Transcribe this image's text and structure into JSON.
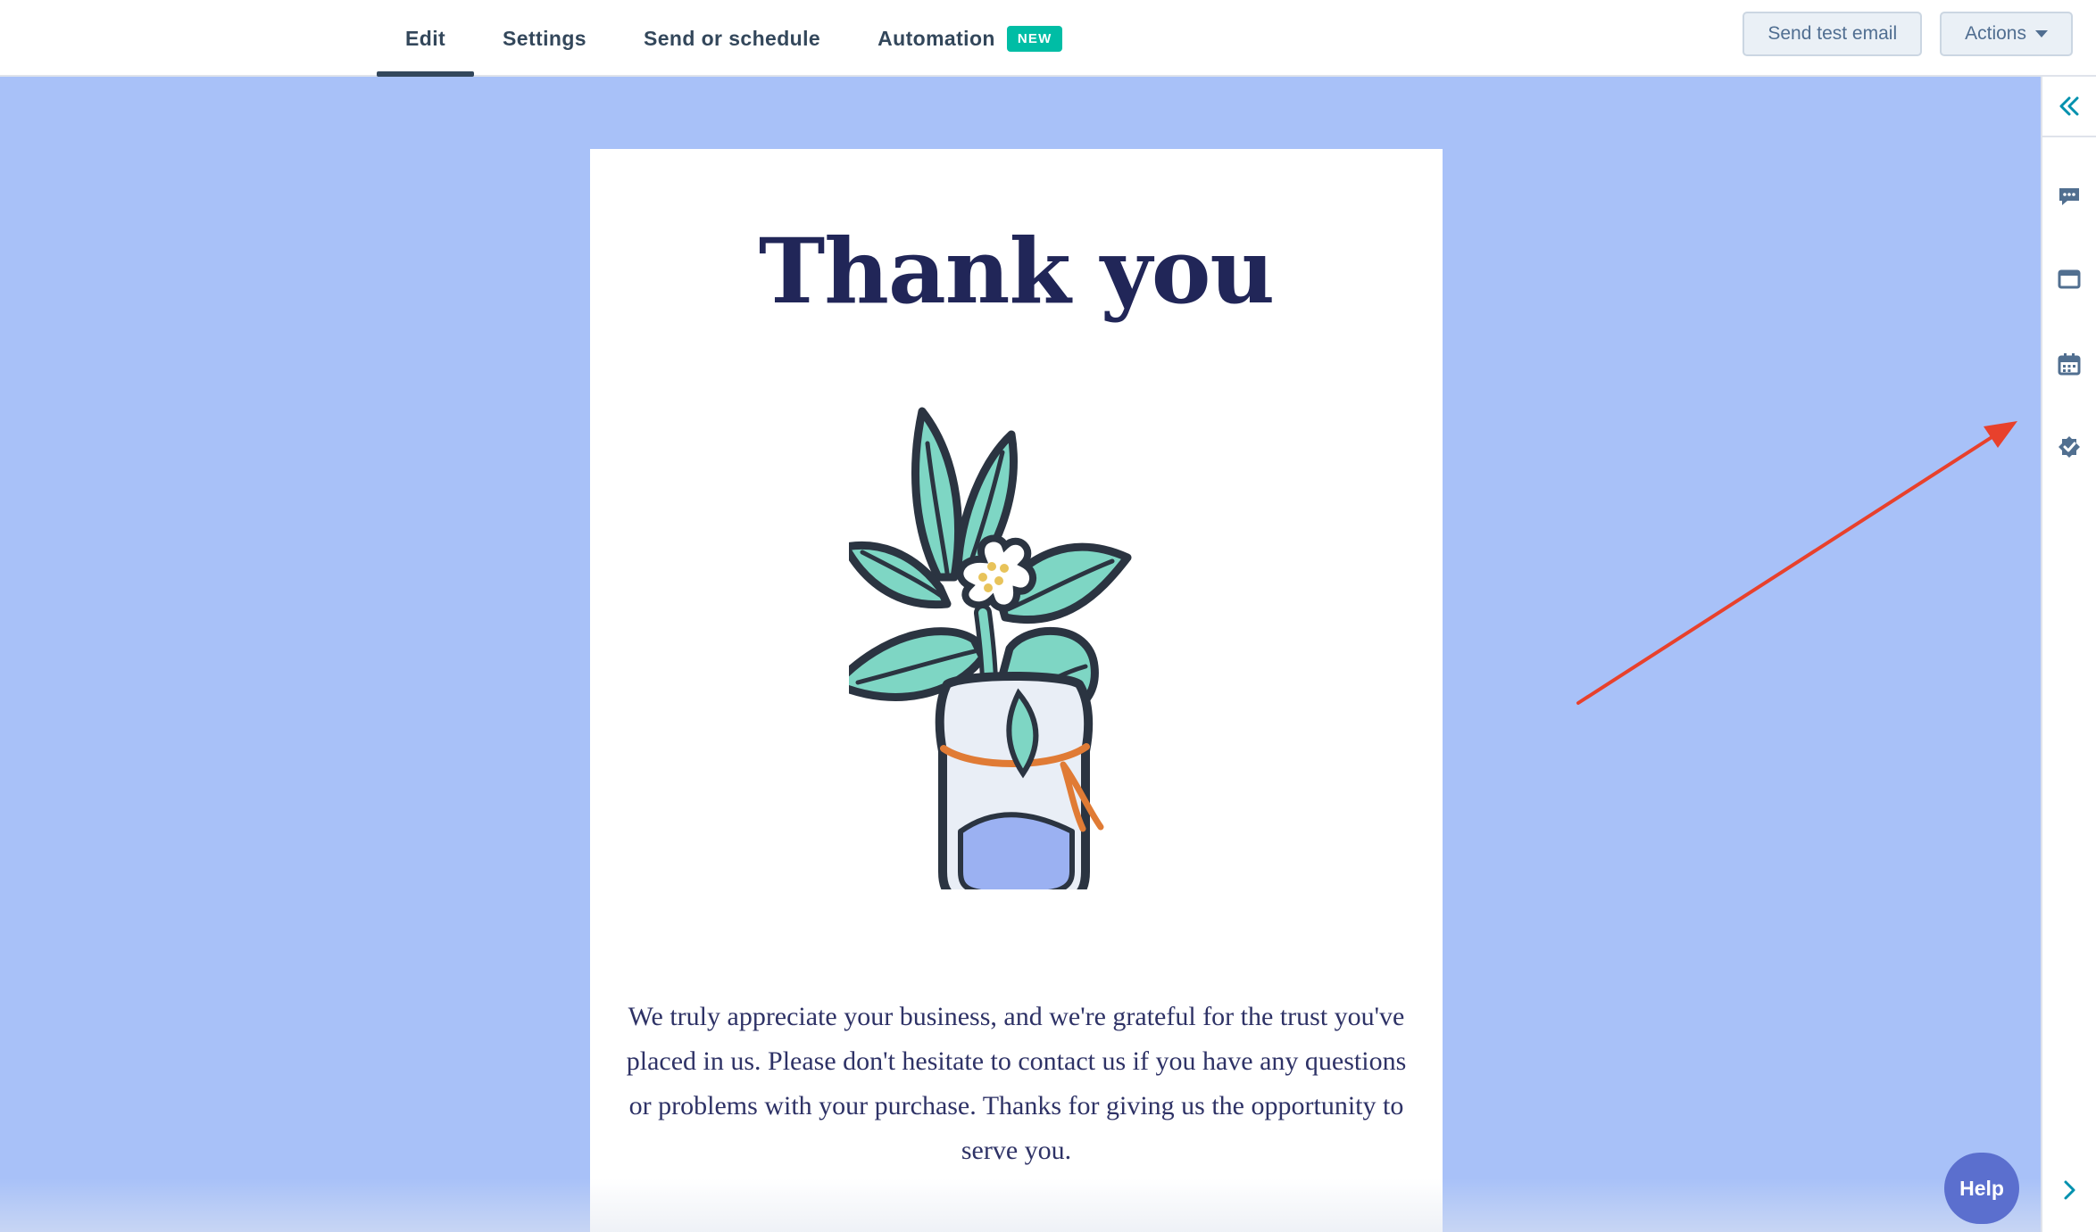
{
  "tabs": [
    {
      "label": "Edit",
      "active": true
    },
    {
      "label": "Settings"
    },
    {
      "label": "Send or schedule"
    },
    {
      "label": "Automation",
      "badge": "NEW"
    }
  ],
  "actions": {
    "send_test": "Send test email",
    "actions": "Actions"
  },
  "rail": {
    "icons": [
      "collapse-double-chevron-icon",
      "comments-icon",
      "preview-icon",
      "calendar-icon",
      "checklist-badge-icon",
      "chevron-right-icon"
    ]
  },
  "email": {
    "title": "Thank you",
    "body": "We truly appreciate your business, and we're grateful for the trust you've placed in us. Please don't hesitate to contact us if you have any questions or problems with your purchase. Thanks for giving us the opportunity to serve you."
  },
  "help": {
    "label": "Help"
  },
  "colors": {
    "canvas_bg": "#a8c1f8",
    "title": "#212658",
    "badge": "#00bda5",
    "help": "#5b6fce",
    "arrow": "#e8412c"
  }
}
